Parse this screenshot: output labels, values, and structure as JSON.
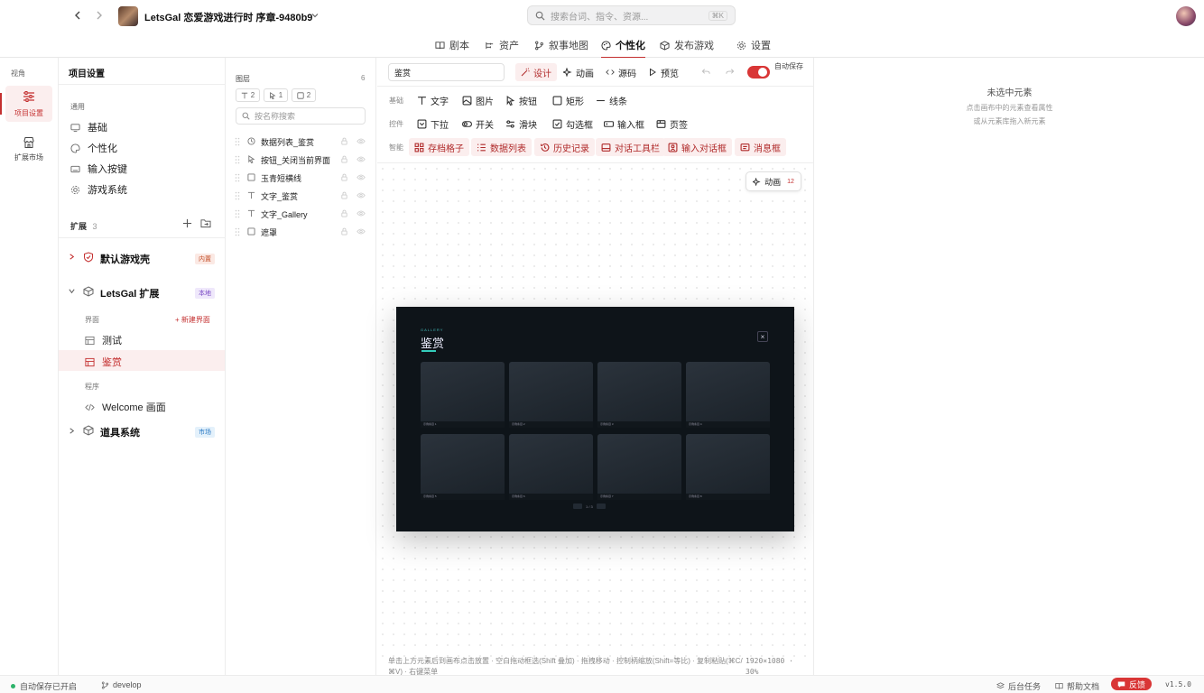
{
  "app": {
    "title": "LetsGal 恋爱游戏进行时 序章-9480b9",
    "search_placeholder": "搜索台词、指令、资源...",
    "search_shortcut": "⌘K"
  },
  "nav": {
    "tabs": [
      {
        "label": "剧本",
        "icon": "book-icon"
      },
      {
        "label": "资产",
        "icon": "assets-icon"
      },
      {
        "label": "叙事地图",
        "icon": "branch-icon"
      },
      {
        "label": "个性化",
        "icon": "palette-icon"
      },
      {
        "label": "发布游戏",
        "icon": "box-icon"
      },
      {
        "label": "设置",
        "icon": "gear-icon"
      }
    ],
    "active": "个性化"
  },
  "rail": {
    "title": "视角",
    "items": [
      {
        "label": "项目设置",
        "icon": "sliders-icon",
        "active": true
      },
      {
        "label": "扩展市场",
        "icon": "store-icon"
      }
    ]
  },
  "project": {
    "title": "项目设置",
    "general_label": "通用",
    "general_items": [
      {
        "label": "基础",
        "icon": "monitor-icon"
      },
      {
        "label": "个性化",
        "icon": "palette-icon"
      },
      {
        "label": "输入按键",
        "icon": "keyboard-icon"
      },
      {
        "label": "游戏系统",
        "icon": "gear-icon"
      }
    ],
    "ext_label": "扩展",
    "ext_count": "3",
    "extensions": [
      {
        "name": "默认游戏壳",
        "badge": "内置"
      },
      {
        "name": "LetsGal 扩展",
        "badge": "本地"
      },
      {
        "name": "道具系统",
        "badge": "市场"
      }
    ],
    "ui_label": "界面",
    "new_ui": "+ 新建界面",
    "ui_items": [
      "测试",
      "鉴赏"
    ],
    "program_label": "程序",
    "program_items": [
      "Welcome 画面"
    ]
  },
  "layers": {
    "title": "图层",
    "count": "6",
    "filters": [
      "2",
      "1",
      "2"
    ],
    "search_placeholder": "按名称搜索",
    "items": [
      "数据列表_鉴赏",
      "按钮_关闭当前界面",
      "玉青短横线",
      "文字_鉴赏",
      "文字_Gallery",
      "遮罩"
    ]
  },
  "editor": {
    "name_value": "鉴赏",
    "modes": [
      "设计",
      "动画",
      "源码",
      "预览"
    ],
    "autosave": "自动保存",
    "rows": [
      {
        "label": "基础",
        "items": [
          "文字",
          "图片",
          "按钮",
          "矩形",
          "线条"
        ]
      },
      {
        "label": "控件",
        "items": [
          "下拉",
          "开关",
          "滑块",
          "勾选框",
          "输入框",
          "页签"
        ]
      },
      {
        "label": "智能",
        "items": [
          "存档格子",
          "数据列表",
          "历史记录",
          "对话工具栏",
          "输入对话框",
          "消息框"
        ]
      }
    ],
    "anim_button": "动画",
    "anim_count": "12",
    "hint": "单击上方元素后到画布点击放置 · 空白拖动框选(Shift 叠加) · 拖拽移动 · 控制柄缩放(Shift=等比) · 复制粘贴(⌘C/⌘V) · 右键菜单",
    "canvas_info": "1920×1080 · 30%"
  },
  "preview": {
    "eyebrow": "GALLERY",
    "title": "鉴赏",
    "close": "×",
    "cards": [
      "示例条目 1",
      "示例条目 2",
      "示例条目 3",
      "示例条目 4",
      "示例条目 5",
      "示例条目 6",
      "示例条目 7",
      "示例条目 8"
    ],
    "pager": "1 / 3"
  },
  "props": {
    "empty_title": "未选中元素",
    "empty_line1": "点击画布中的元素查看属性",
    "empty_line2": "或从元素库拖入新元素"
  },
  "status": {
    "autosave": "自动保存已开启",
    "branch": "develop",
    "tasks": "后台任务",
    "help": "帮助文档",
    "feedback": "反馈",
    "version": "v1.5.0"
  },
  "colors": {
    "accent": "#c43030",
    "toggle": "#d93636"
  }
}
